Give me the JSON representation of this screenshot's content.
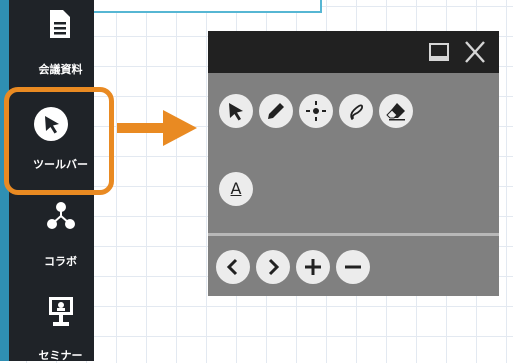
{
  "sidebar": {
    "items": [
      {
        "label": "会議資料",
        "icon": "document-icon"
      },
      {
        "label": "ツールバー",
        "icon": "cursor-icon"
      },
      {
        "label": "コラボ",
        "icon": "collaboration-icon"
      },
      {
        "label": "セミナー",
        "icon": "seminar-icon"
      }
    ]
  },
  "colors": {
    "accent": "#e98a22",
    "sidebar_bg": "#1f2328",
    "sidebar_border": "#2f8fb3",
    "panel_bg": "#808080",
    "panel_header": "#212121"
  },
  "toolbar_panel": {
    "window_buttons": [
      "maximize-icon",
      "close-icon"
    ],
    "tools_row1": [
      "select-arrow-icon",
      "pen-icon",
      "pointer-crosshair-icon",
      "lasso-icon",
      "eraser-icon"
    ],
    "tools_row2": [
      {
        "icon": "text-tool-icon",
        "label": "A"
      }
    ],
    "nav_buttons": [
      "previous-icon",
      "next-icon",
      "zoom-in-icon",
      "zoom-out-icon"
    ]
  }
}
